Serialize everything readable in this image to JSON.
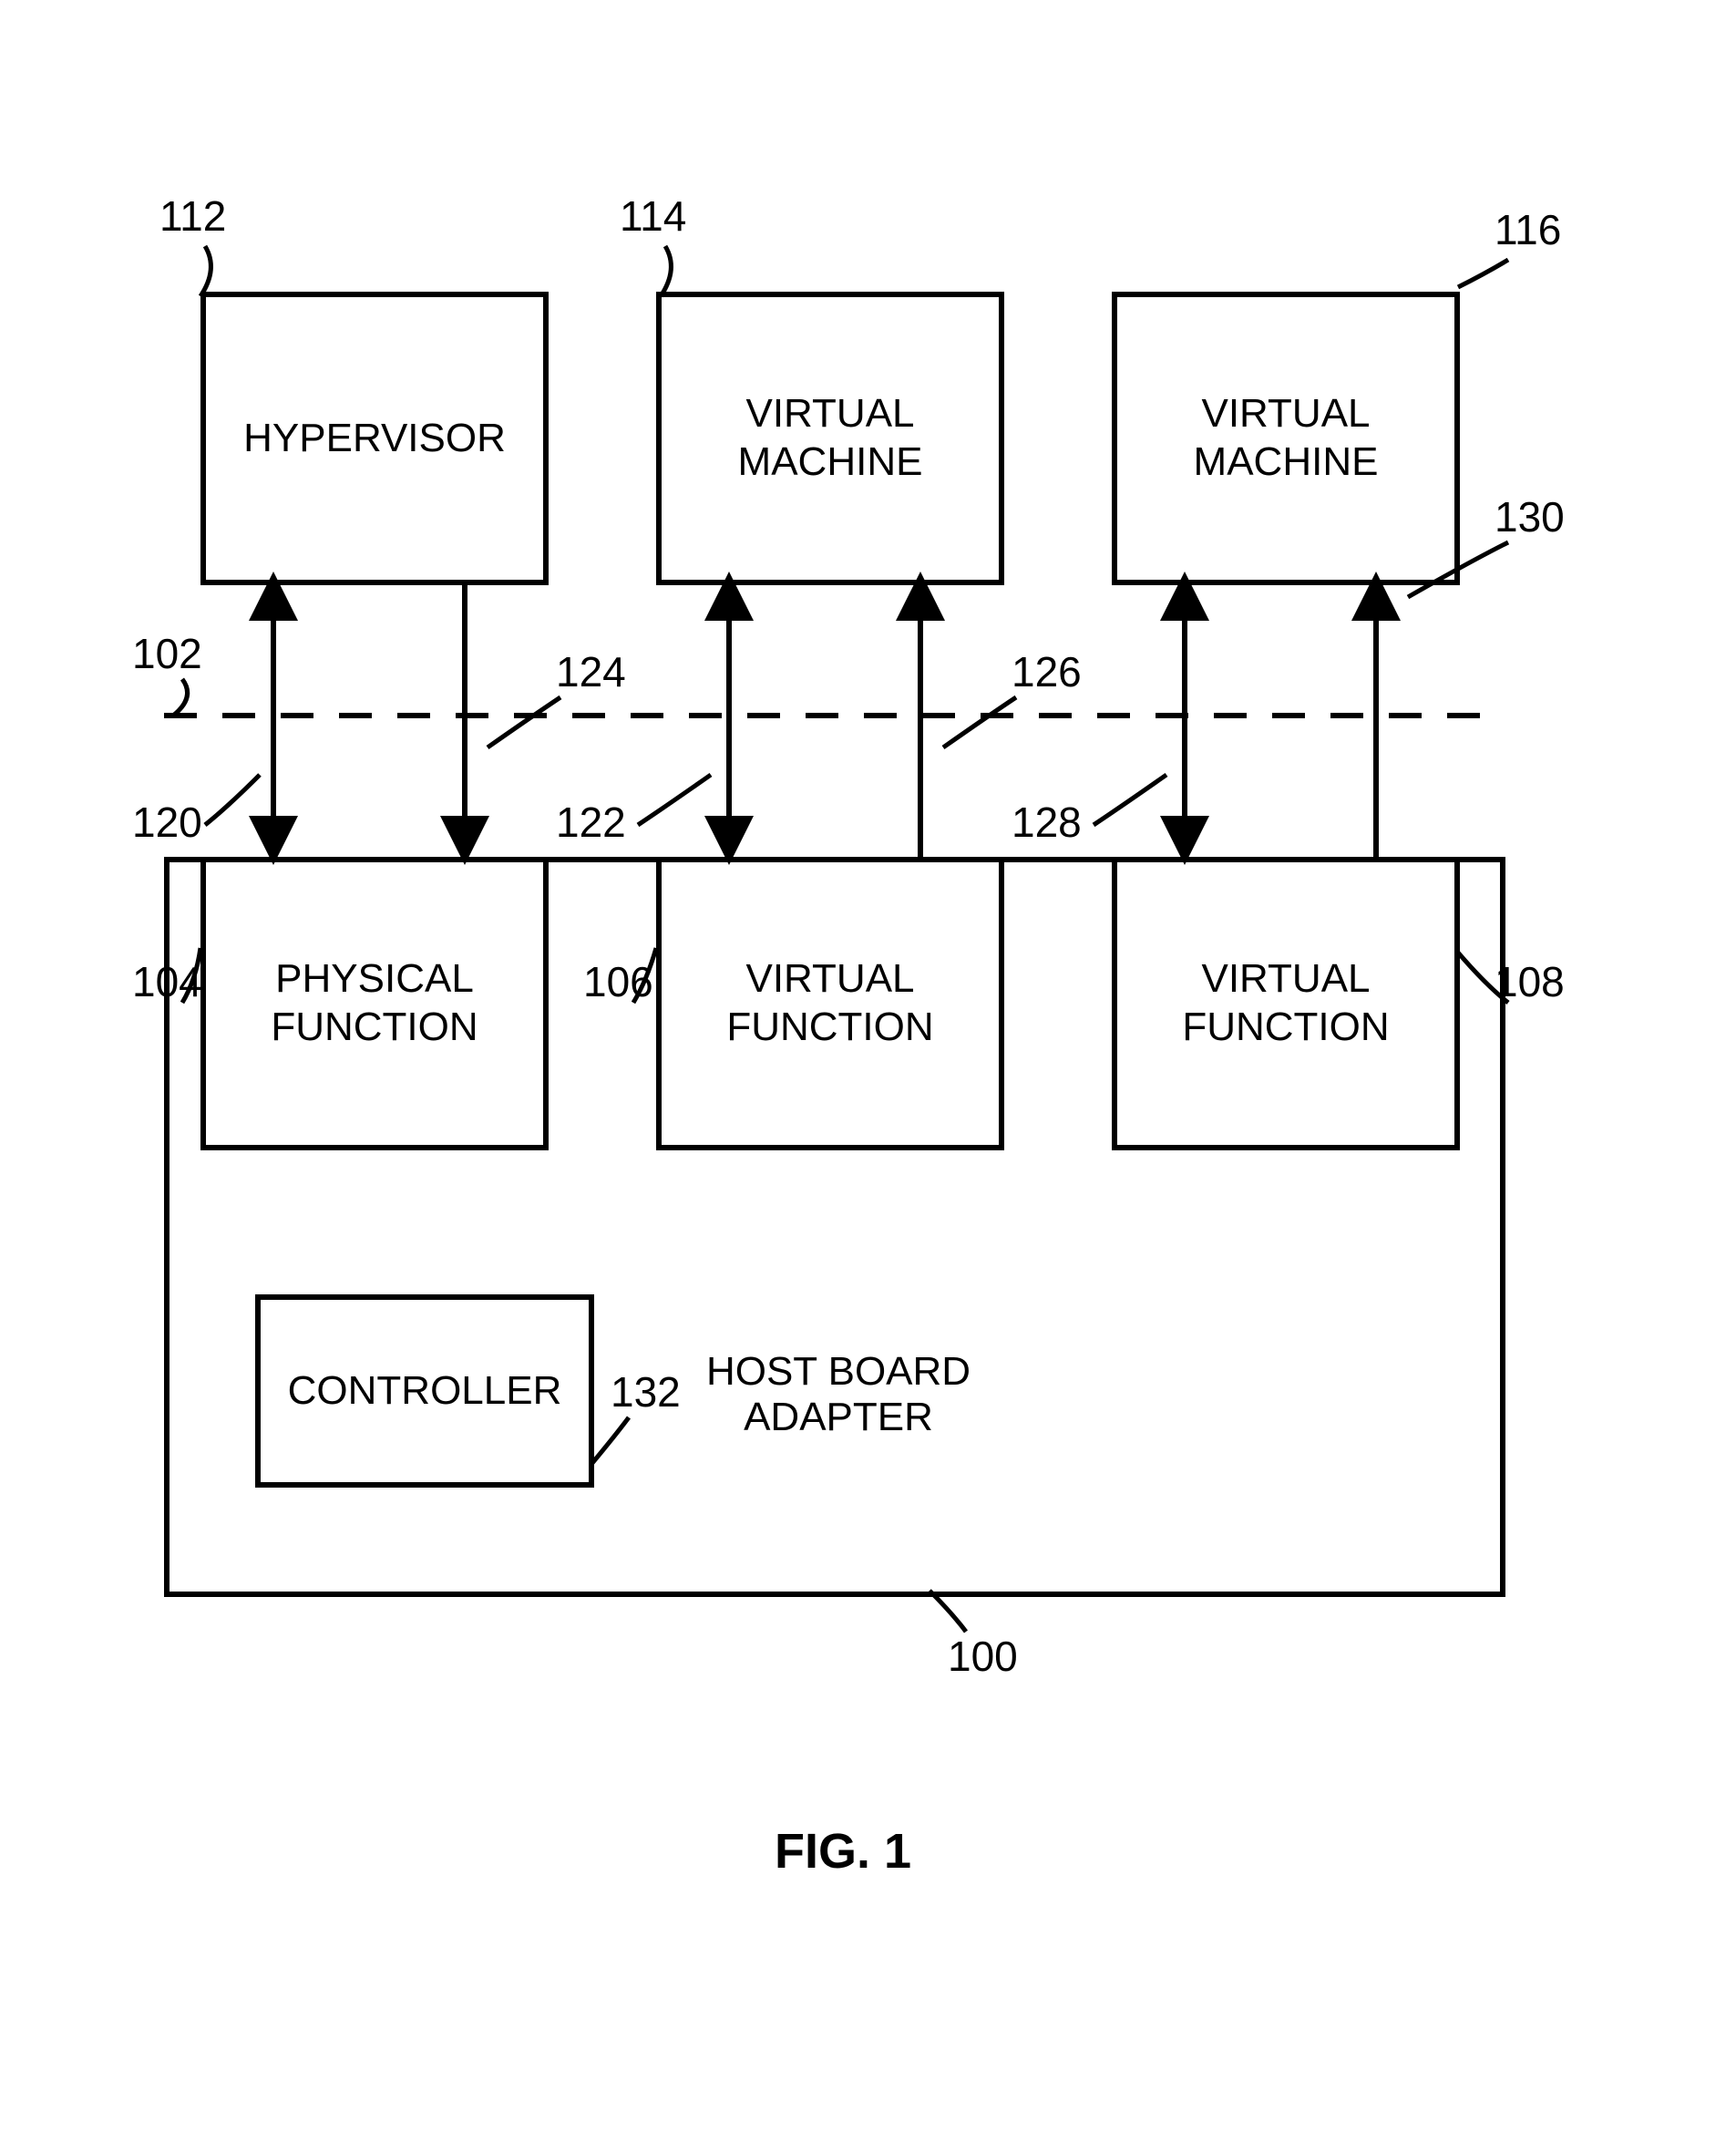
{
  "figure_label": "FIG. 1",
  "boxes": {
    "hypervisor": "HYPERVISOR",
    "vm1": "VIRTUAL MACHINE",
    "vm2": "VIRTUAL MACHINE",
    "pf": "PHYSICAL\nFUNCTION",
    "vf1": "VIRTUAL\nFUNCTION",
    "vf2": "VIRTUAL\nFUNCTION",
    "controller": "CONTROLLER",
    "hba": "HOST BOARD ADAPTER"
  },
  "refs": {
    "r112": "112",
    "r114": "114",
    "r116": "116",
    "r102": "102",
    "r120": "120",
    "r124": "124",
    "r122": "122",
    "r126": "126",
    "r128": "128",
    "r130": "130",
    "r104": "104",
    "r106": "106",
    "r108": "108",
    "r132": "132",
    "r100": "100"
  }
}
